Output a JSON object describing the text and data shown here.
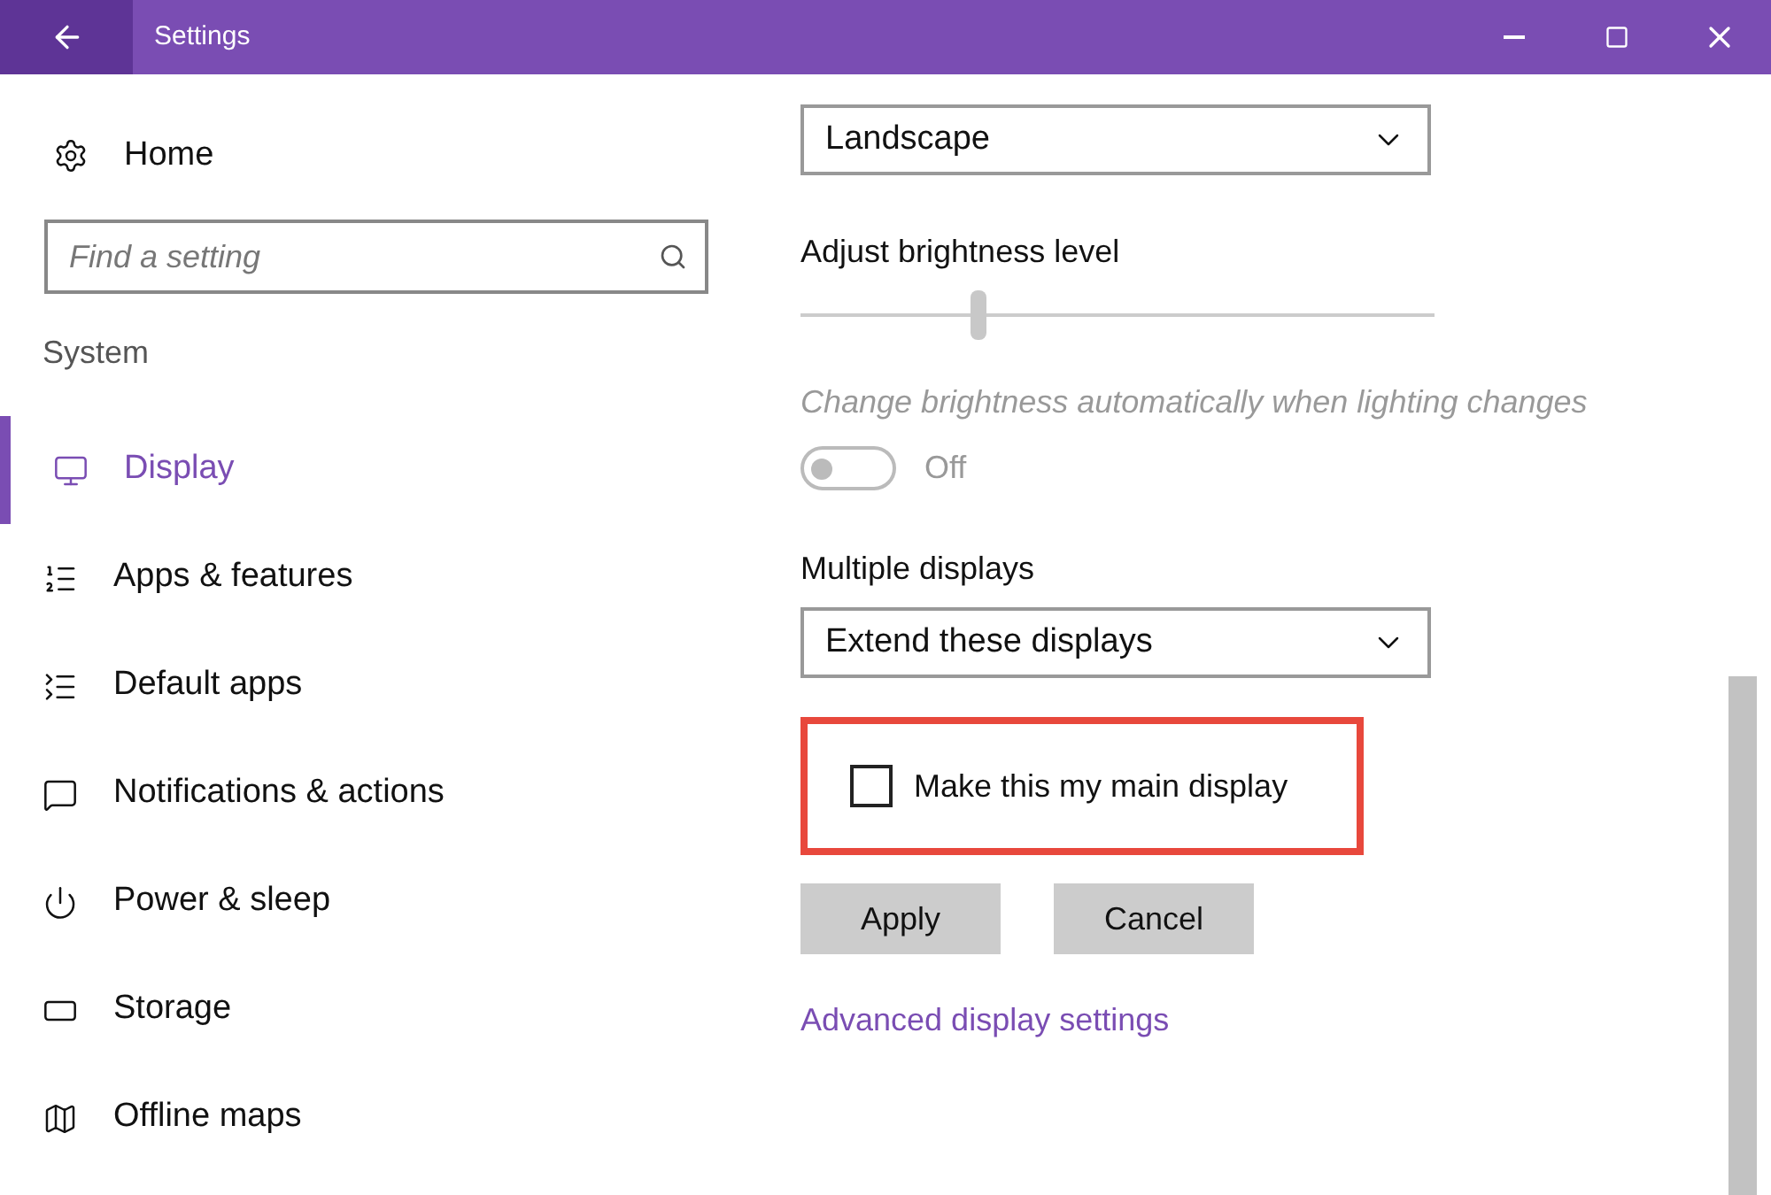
{
  "window": {
    "title": "Settings"
  },
  "sidebar": {
    "home": "Home",
    "search": {
      "placeholder": "Find a setting"
    },
    "section": "System",
    "items": [
      {
        "label": "Display",
        "selected": true
      },
      {
        "label": "Apps & features",
        "selected": false
      },
      {
        "label": "Default apps",
        "selected": false
      },
      {
        "label": "Notifications & actions",
        "selected": false
      },
      {
        "label": "Power & sleep",
        "selected": false
      },
      {
        "label": "Storage",
        "selected": false
      },
      {
        "label": "Offline maps",
        "selected": false
      }
    ]
  },
  "content": {
    "orientation": {
      "value": "Landscape"
    },
    "brightness": {
      "label": "Adjust brightness level",
      "level": 0.28,
      "disabled": true
    },
    "auto_brightness": {
      "label": "Change brightness automatically when lighting changes",
      "on": false,
      "state_text": "Off",
      "disabled": true
    },
    "multiple_displays": {
      "label": "Multiple displays",
      "value": "Extend these displays"
    },
    "main_display": {
      "label": "Make this my main display",
      "checked": false,
      "highlighted": true
    },
    "buttons": [
      "Apply",
      "Cancel"
    ],
    "link": "Advanced display settings"
  }
}
